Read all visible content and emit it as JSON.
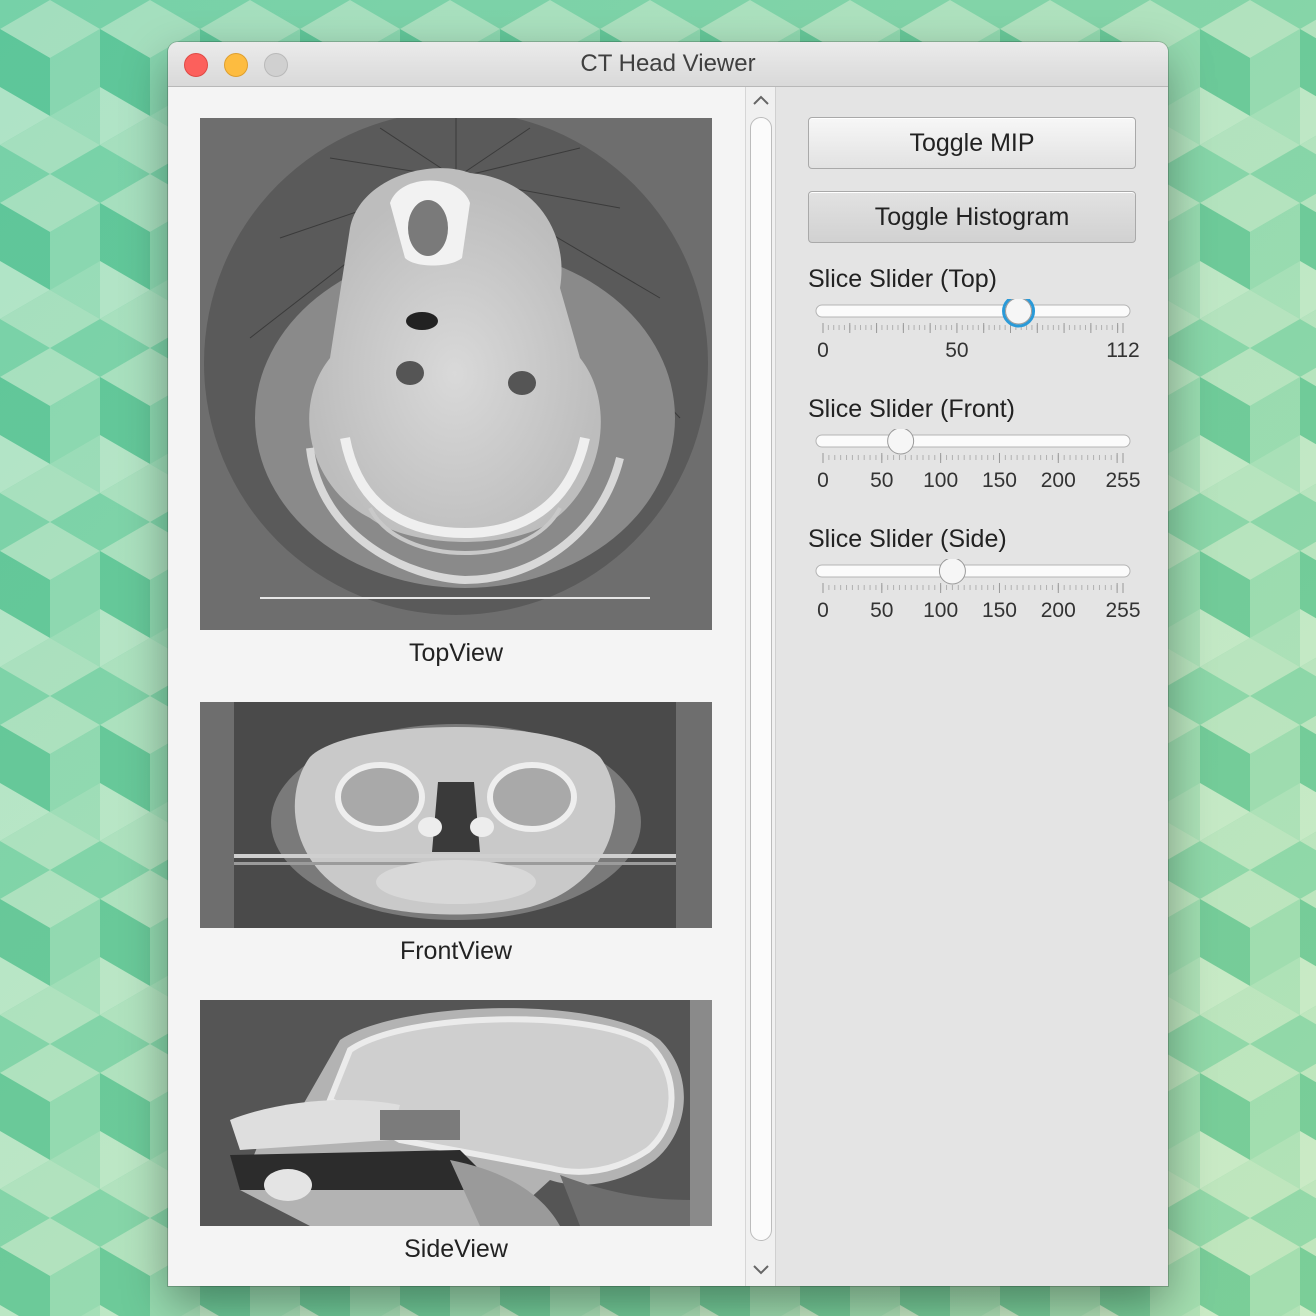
{
  "window": {
    "title": "CT Head Viewer"
  },
  "views": [
    {
      "label": "TopView"
    },
    {
      "label": "FrontView"
    },
    {
      "label": "SideView"
    }
  ],
  "buttons": {
    "toggle_mip": "Toggle MIP",
    "toggle_histogram": "Toggle Histogram"
  },
  "sliders": [
    {
      "label": "Slice Slider (Top)",
      "min": 0,
      "max": 112,
      "value": 73,
      "focused": true,
      "tick_labels": [
        0,
        50,
        112
      ],
      "major_ticks": [
        0,
        10,
        20,
        30,
        40,
        50,
        60,
        70,
        80,
        90,
        100,
        110,
        112
      ]
    },
    {
      "label": "Slice Slider (Front)",
      "min": 0,
      "max": 255,
      "value": 66,
      "focused": false,
      "tick_labels": [
        0,
        50,
        100,
        150,
        200,
        255
      ],
      "major_ticks": [
        0,
        50,
        100,
        150,
        200,
        250,
        255
      ]
    },
    {
      "label": "Slice Slider (Side)",
      "min": 0,
      "max": 255,
      "value": 110,
      "focused": false,
      "tick_labels": [
        0,
        50,
        100,
        150,
        200,
        255
      ],
      "major_ticks": [
        0,
        50,
        100,
        150,
        200,
        250,
        255
      ]
    }
  ],
  "colors": {
    "focus_ring": "#2a9ad8",
    "close": "#fc605c",
    "minimize": "#fdbc40",
    "maximize": "#d0d0d0"
  }
}
